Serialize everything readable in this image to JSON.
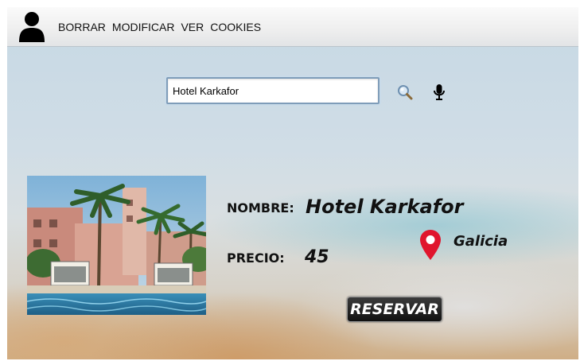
{
  "header": {
    "user_icon": "user-icon",
    "menu": [
      "BORRAR",
      "MODIFICAR",
      "VER",
      "COOKIES"
    ]
  },
  "search": {
    "value": "Hotel Karkafor",
    "search_icon": "magnifier-icon",
    "mic_icon": "microphone-icon"
  },
  "hotel": {
    "name_label": "NOMBRE:",
    "name": "Hotel Karkafor",
    "price_label": "PRECIO:",
    "price": "45",
    "location": "Galicia",
    "location_icon": "map-pin-icon",
    "reserve_label": "RESERVAR"
  },
  "colors": {
    "pin": "#e0152d",
    "button": "#1c1c1c"
  }
}
